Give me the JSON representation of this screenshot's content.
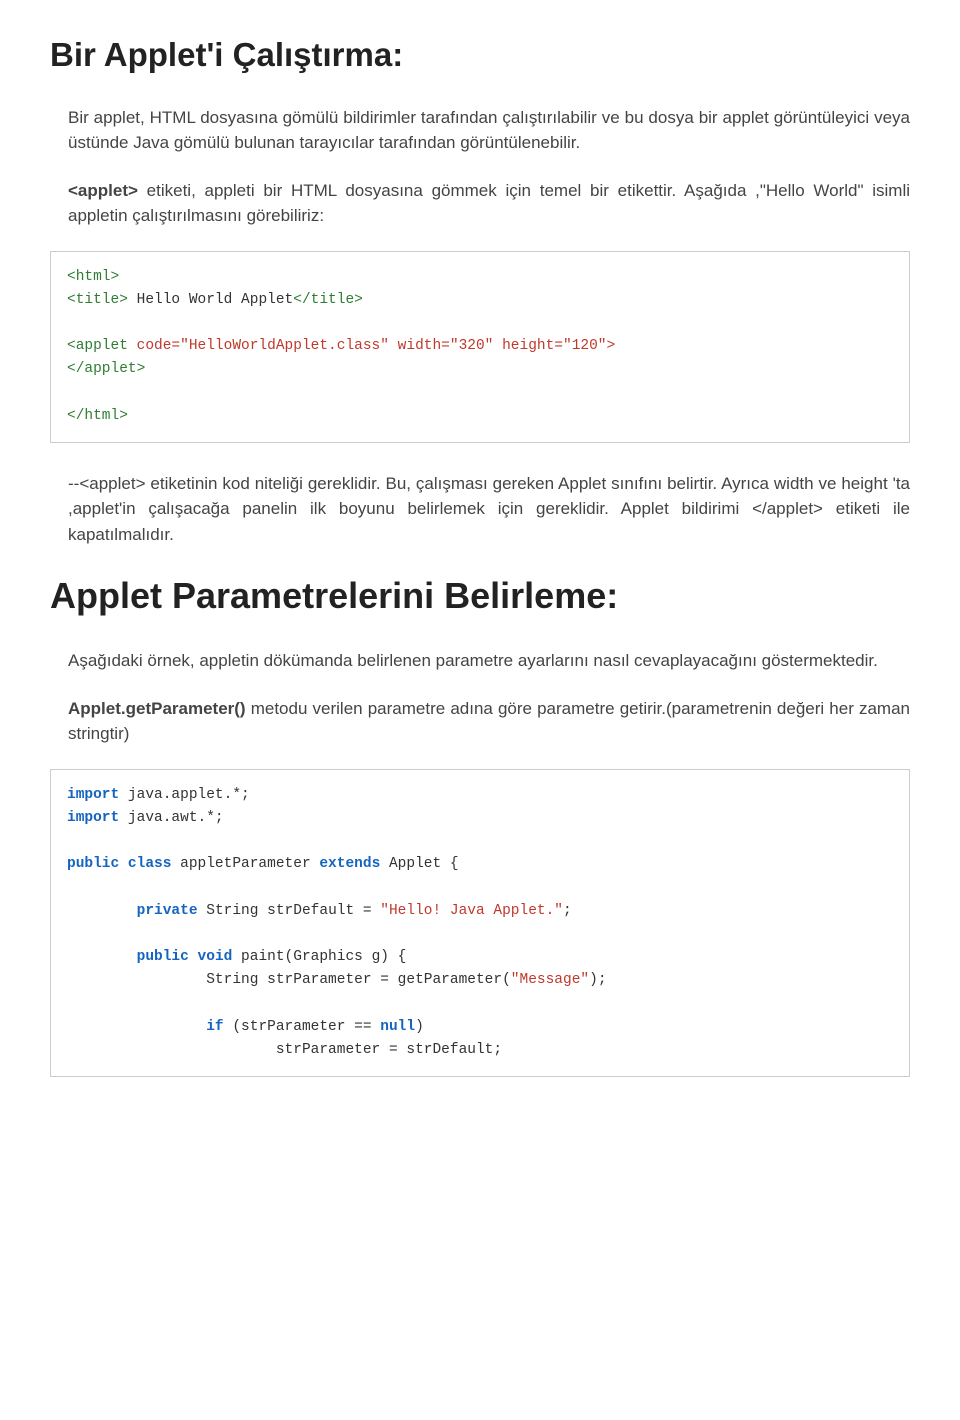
{
  "heading1": "Bir Applet'i Çalıştırma:",
  "para1": "Bir applet, HTML dosyasına gömülü bildirimler tarafından çalıştırılabilir ve bu dosya bir applet görüntüleyici veya üstünde Java gömülü bulunan tarayıcılar tarafından görüntülenebilir.",
  "para2_prefix": "<applet>",
  "para2_rest": " etiketi, appleti bir HTML dosyasına gömmek için temel bir etikettir. Aşağıda ,\"Hello World\" isimli appletin çalıştırılmasını görebiliriz:",
  "code1": {
    "l1": "<html>",
    "l2a": "<title>",
    "l2b": " Hello World Applet",
    "l2c": "</title>",
    "l3a": "<applet",
    "l3b": " code=\"HelloWorldApplet.class\"",
    "l3c": " width=\"320\"",
    "l3d": " height=\"120\">",
    "l4": "</applet>",
    "l5": "</html>"
  },
  "para3": "--<applet> etiketinin kod niteliği gereklidir. Bu, çalışması gereken Applet sınıfını belirtir. Ayrıca width ve height 'ta ,applet'in çalışacağa panelin ilk boyunu belirlemek için gereklidir. Applet bildirimi </applet> etiketi ile kapatılmalıdır.",
  "heading2": "Applet Parametrelerini Belirleme:",
  "para4": "Aşağıdaki örnek, appletin dökümanda belirlenen parametre ayarlarını nasıl cevaplayacağını göstermektedir.",
  "para5_bold": "Applet.getParameter()",
  "para5_rest": " metodu verilen parametre adına göre parametre getirir.(parametrenin değeri her zaman stringtir)",
  "code2": {
    "l1a": "import",
    "l1b": " java.applet.*;",
    "l2a": "import",
    "l2b": " java.awt.*;",
    "l4a": "public class",
    "l4b": " appletParameter ",
    "l4c": "extends",
    "l4d": " Applet {",
    "l6a": "private",
    "l6b": " String strDefault = ",
    "l6c": "\"Hello! Java Applet.\"",
    "l6d": ";",
    "l8a": "public void",
    "l8b": " paint(Graphics g) {",
    "l9a": "String strParameter = getParameter(",
    "l9b": "\"Message\"",
    "l9c": ");",
    "l11a": "if",
    "l11b": " (strParameter == ",
    "l11c": "null",
    "l11d": ")",
    "l12": "strParameter = strDefault;"
  }
}
